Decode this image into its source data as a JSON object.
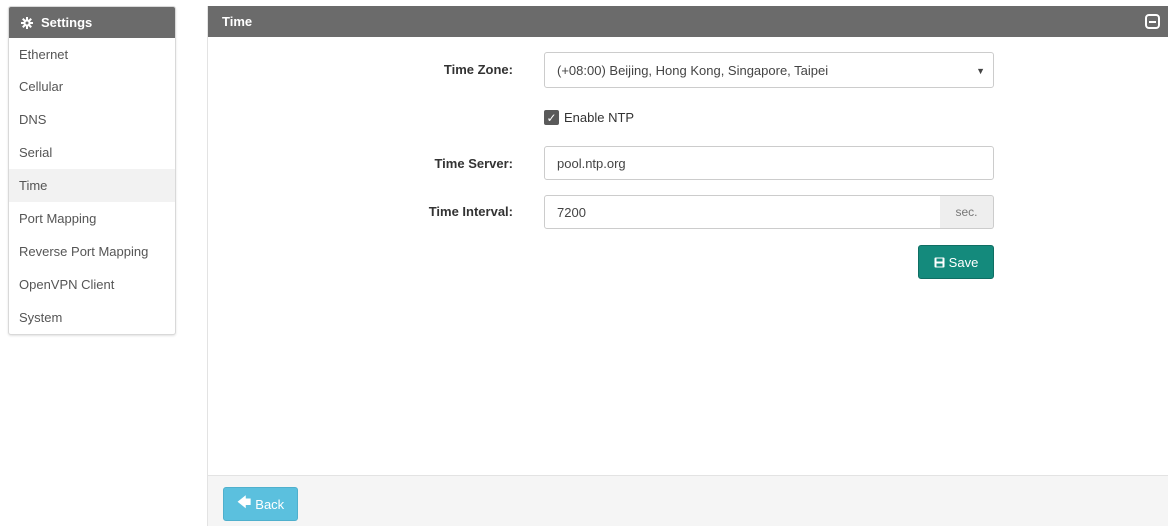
{
  "sidebar": {
    "title": "Settings",
    "title_icon": "gear-icon",
    "items": [
      {
        "label": "Ethernet"
      },
      {
        "label": "Cellular"
      },
      {
        "label": "DNS"
      },
      {
        "label": "Serial"
      },
      {
        "label": "Time",
        "active": true
      },
      {
        "label": "Port Mapping"
      },
      {
        "label": "Reverse Port Mapping"
      },
      {
        "label": "OpenVPN Client"
      },
      {
        "label": "System"
      }
    ]
  },
  "panel": {
    "title": "Time",
    "collapse_icon": "collapse-icon"
  },
  "form": {
    "time_zone_label": "Time Zone:",
    "time_zone_value": "(+08:00) Beijing, Hong Kong, Singapore, Taipei",
    "ntp_checkbox_label": "Enable NTP",
    "ntp_enabled": true,
    "time_server_label": "Time Server:",
    "time_server_value": "pool.ntp.org",
    "time_interval_label": "Time Interval:",
    "time_interval_value": "7200",
    "time_interval_unit": "sec.",
    "save_label": "Save"
  },
  "footer": {
    "back_label": "Back"
  },
  "colors": {
    "header_bg": "#6b6b6b",
    "save_button": "#148a7c",
    "back_button": "#5bc0de"
  }
}
